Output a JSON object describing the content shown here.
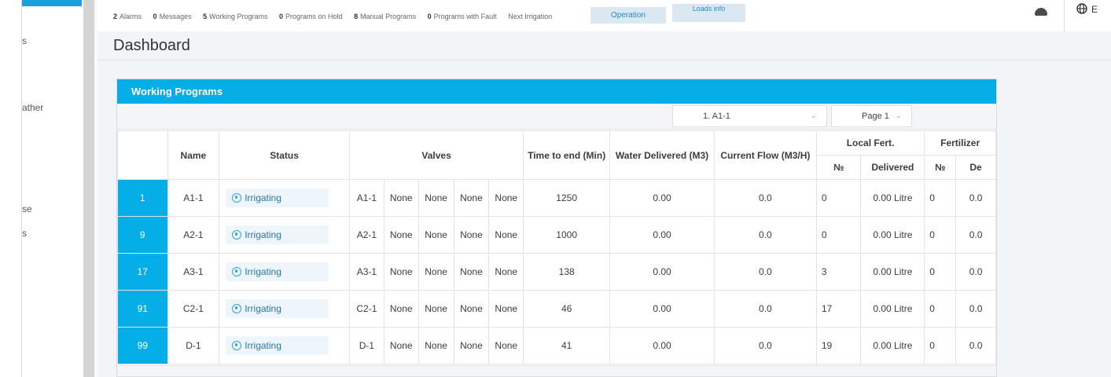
{
  "sidebar": {
    "items": [
      {
        "label": "s"
      },
      {
        "label": "ather"
      },
      {
        "label": "se"
      },
      {
        "label": "s"
      }
    ]
  },
  "topbar": {
    "stats": [
      {
        "count": "2",
        "label": "Alarms"
      },
      {
        "count": "0",
        "label": "Messages"
      },
      {
        "count": "5",
        "label": "Working Programs"
      },
      {
        "count": "0",
        "label": "Programs on Hold"
      },
      {
        "count": "8",
        "label": "Manual Programs"
      },
      {
        "count": "0",
        "label": "Programs with Fault"
      }
    ],
    "next_irrigation": "Next Irrigation",
    "operation_button": "Operation",
    "loads_button": "Loads info",
    "lang_label": "E"
  },
  "page": {
    "title": "Dashboard"
  },
  "card": {
    "title": "Working Programs",
    "program_select": "1. A1-1",
    "page_select": "Page 1"
  },
  "table": {
    "headers": {
      "name": "Name",
      "status": "Status",
      "valves": "Valves",
      "time_to_end": "Time to end (Min)",
      "water_delivered": "Water Delivered (M3)",
      "current_flow": "Current Flow (M3/H)",
      "local_fert": "Local Fert.",
      "local_no": "№",
      "local_delivered": "Delivered",
      "fertilizer": "Fertilizer",
      "fert_no": "№",
      "fert_delivered": "De"
    },
    "rows": [
      {
        "num": "1",
        "name": "A1-1",
        "status": "Irrigating",
        "valves": [
          "A1-1",
          "None",
          "None",
          "None",
          "None"
        ],
        "time": "1250",
        "water": "0.00",
        "flow": "0.0",
        "lf_no": "0",
        "lf_del": "0.00 Litre",
        "f_no": "0",
        "f_del": "0.0"
      },
      {
        "num": "9",
        "name": "A2-1",
        "status": "Irrigating",
        "valves": [
          "A2-1",
          "None",
          "None",
          "None",
          "None"
        ],
        "time": "1000",
        "water": "0.00",
        "flow": "0.0",
        "lf_no": "0",
        "lf_del": "0.00 Litre",
        "f_no": "0",
        "f_del": "0.0"
      },
      {
        "num": "17",
        "name": "A3-1",
        "status": "Irrigating",
        "valves": [
          "A3-1",
          "None",
          "None",
          "None",
          "None"
        ],
        "time": "138",
        "water": "0.00",
        "flow": "0.0",
        "lf_no": "3",
        "lf_del": "0.00 Litre",
        "f_no": "0",
        "f_del": "0.0"
      },
      {
        "num": "91",
        "name": "C2-1",
        "status": "Irrigating",
        "valves": [
          "C2-1",
          "None",
          "None",
          "None",
          "None"
        ],
        "time": "46",
        "water": "0.00",
        "flow": "0.0",
        "lf_no": "17",
        "lf_del": "0.00 Litre",
        "f_no": "0",
        "f_del": "0.0"
      },
      {
        "num": "99",
        "name": "D-1",
        "status": "Irrigating",
        "valves": [
          "D-1",
          "None",
          "None",
          "None",
          "None"
        ],
        "time": "41",
        "water": "0.00",
        "flow": "0.0",
        "lf_no": "19",
        "lf_del": "0.00 Litre",
        "f_no": "0",
        "f_del": "0.0"
      }
    ]
  },
  "colors": {
    "accent": "#06aee8",
    "status_text": "#2a76a8"
  },
  "icons": {
    "status": "water-drop-icon",
    "user": "user-icon",
    "language": "globe-icon",
    "dropdown": "chevron-down-icon"
  }
}
